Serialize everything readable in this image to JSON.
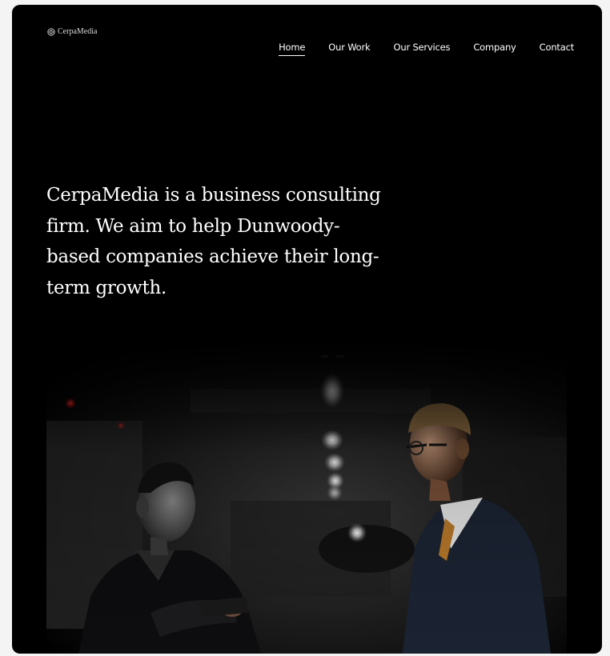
{
  "site": {
    "logo_text": "CerpaMedia",
    "logo_icon": "logo-mark-icon"
  },
  "nav": {
    "items": [
      {
        "label": "Home",
        "active": true
      },
      {
        "label": "Our Work",
        "active": false
      },
      {
        "label": "Our Services",
        "active": false
      },
      {
        "label": "Company",
        "active": false
      },
      {
        "label": "Contact",
        "active": false
      }
    ]
  },
  "hero": {
    "headline": "CerpaMedia is a business consulting firm. We aim to help Dunwoody-based companies achieve their long-term growth."
  },
  "colors": {
    "background": "#000000",
    "text": "#ffffff",
    "accent_red": "#e02020"
  }
}
